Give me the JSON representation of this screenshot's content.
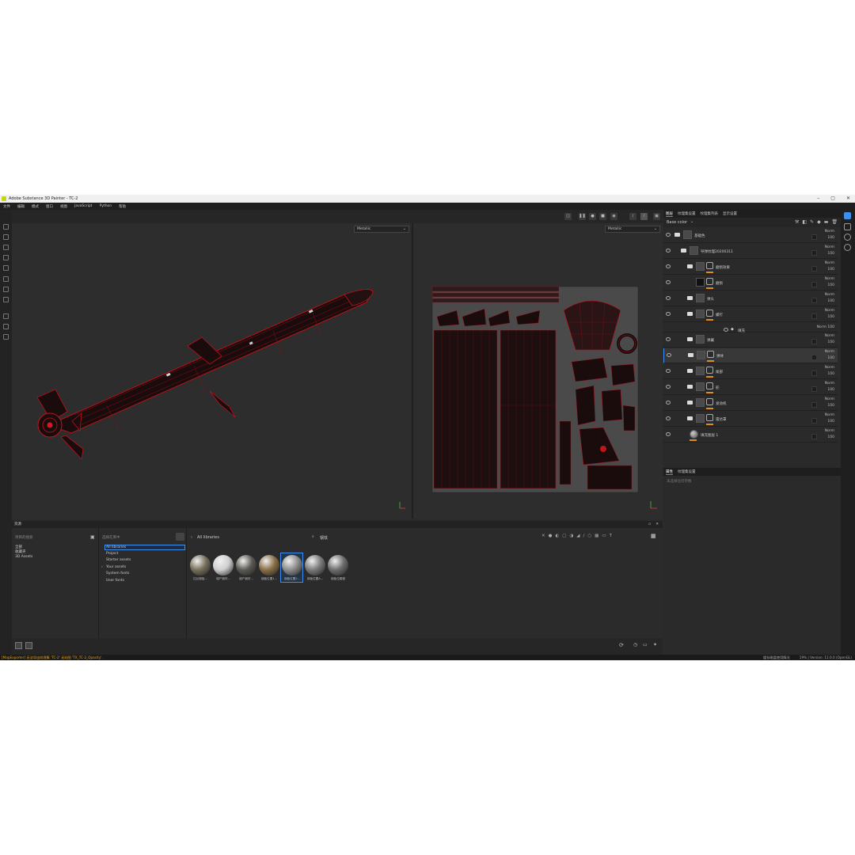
{
  "window": {
    "title": "Adobe Substance 3D Painter - TC-2",
    "minimize": "–",
    "maximize": "▢",
    "close": "✕"
  },
  "menu": [
    "文件",
    "编辑",
    "模式",
    "窗口",
    "视图",
    "JavaScript",
    "Python",
    "帮助"
  ],
  "viewport": {
    "left_mode": "Metallic",
    "right_mode": "Metallic"
  },
  "layers_panel": {
    "tabs": [
      "图层",
      "纹理集设置",
      "纹理集列表",
      "显示设置"
    ],
    "channel": "Base color",
    "layers": [
      {
        "name": "基础色",
        "blend": "Norm",
        "opacity": "100",
        "type": "folder",
        "indent": 0
      },
      {
        "name": "导弹纹理20200311",
        "blend": "Norm",
        "opacity": "100",
        "type": "folder",
        "indent": 1
      },
      {
        "name": "磨损效果",
        "blend": "Norm",
        "opacity": "100",
        "type": "folder-mask",
        "indent": 2
      },
      {
        "name": "磨损",
        "blend": "Norm",
        "opacity": "100",
        "type": "fill-mask",
        "indent": 2
      },
      {
        "name": "弹头",
        "blend": "Norm",
        "opacity": "100",
        "type": "folder",
        "indent": 2
      },
      {
        "name": "螺钉",
        "blend": "Norm",
        "opacity": "100",
        "type": "folder-mask",
        "indent": 2
      },
      {
        "name": "填充",
        "blend": "Norm",
        "opacity": "100",
        "type": "sub-effect",
        "indent": 3
      },
      {
        "name": "弹翼",
        "blend": "Norm",
        "opacity": "100",
        "type": "folder",
        "indent": 2
      },
      {
        "name": "弹体",
        "blend": "Norm",
        "opacity": "100",
        "type": "folder-mask",
        "indent": 2,
        "selected": true
      },
      {
        "name": "尾部",
        "blend": "Norm",
        "opacity": "100",
        "type": "folder-mask",
        "indent": 2
      },
      {
        "name": "舵",
        "blend": "Norm",
        "opacity": "100",
        "type": "folder-mask",
        "indent": 2
      },
      {
        "name": "发动机",
        "blend": "Norm",
        "opacity": "100",
        "type": "folder-mask",
        "indent": 2
      },
      {
        "name": "雷达罩",
        "blend": "Norm",
        "opacity": "100",
        "type": "folder-mask",
        "indent": 2
      },
      {
        "name": "填充图层 1",
        "blend": "Norm",
        "opacity": "100",
        "type": "fill",
        "indent": 1
      }
    ],
    "props_tabs": [
      "属性",
      "纹理集设置"
    ],
    "props_hint": "未选择任何参数"
  },
  "assets": {
    "header": "资源",
    "col1_label": "项目的搜索",
    "col1_items": [
      "全部",
      "收藏夹",
      "3D Assets"
    ],
    "col2_label": "选择在库中",
    "col2_items": [
      "All libraries",
      "Project",
      "Starter assets",
      "Your assets",
      "System fonts",
      "User fonts"
    ],
    "path": "All libraries",
    "search_value": "钢铁",
    "materials": [
      {
        "label": "拉丝钢板...",
        "color": "#77705c"
      },
      {
        "label": "增产钢材...",
        "color": "#cfcfcf"
      },
      {
        "label": "增产钢材...",
        "color": "#5c5a55"
      },
      {
        "label": "钢板位置1...",
        "color": "#8a6f48"
      },
      {
        "label": "钢板位置2...",
        "color": "#8d8d8d",
        "selected": true
      },
      {
        "label": "钢板位置A...",
        "color": "#7a7a7a"
      },
      {
        "label": "钢板位粗糙",
        "color": "#6e6e6e"
      }
    ]
  },
  "status": {
    "left": "[MapExporter] 无法导出纹理集 'TC-2' 无贴图 'TX_TC-2_Opacity'.",
    "mid": "缓存磁盘使用情况",
    "right": "19% | Version: 11.0.0 (OpenGL)"
  },
  "colors": {
    "accent": "#3d8ef0",
    "warning": "#e8a31a",
    "mesh_red": "#c0141c"
  }
}
